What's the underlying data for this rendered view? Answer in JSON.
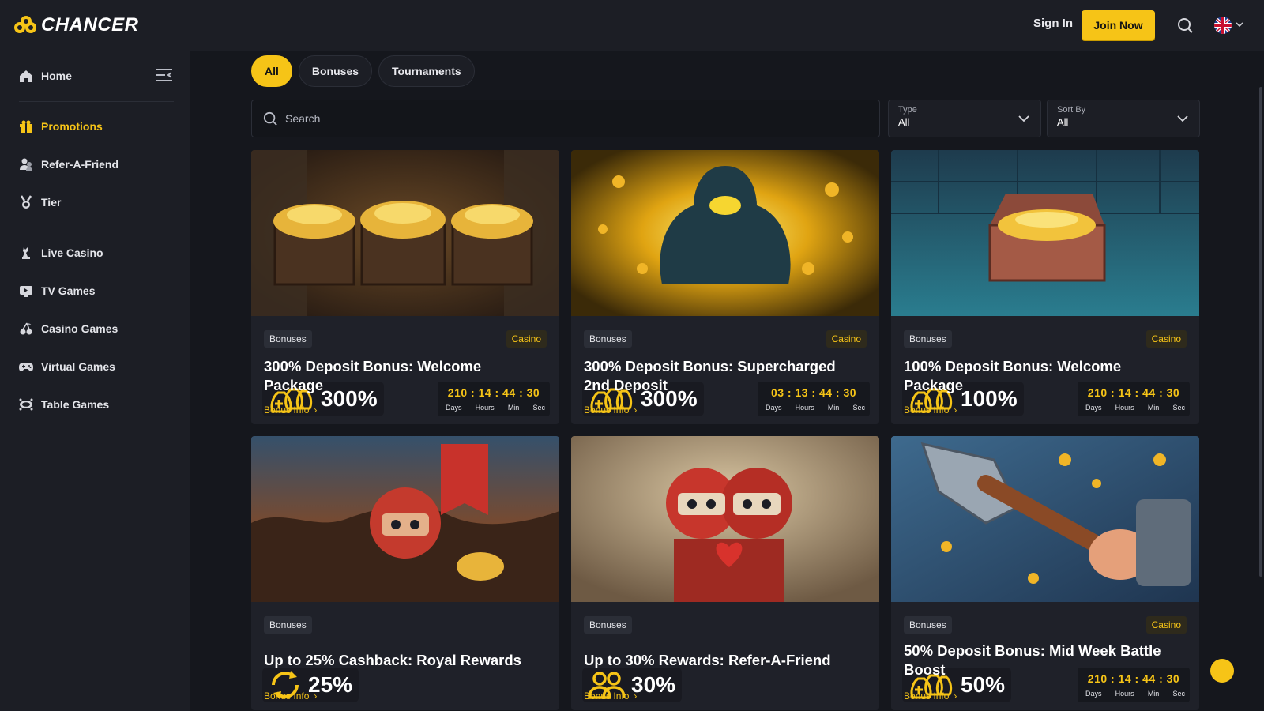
{
  "header": {
    "logo_text": "CHANCER",
    "sign_in": "Sign In",
    "join_now": "Join Now",
    "language_icon": "uk-flag-icon"
  },
  "sidebar": {
    "items": [
      {
        "label": "Home",
        "icon": "home-icon"
      },
      {
        "label": "Promotions",
        "icon": "gift-icon",
        "active": true
      },
      {
        "label": "Refer-A-Friend",
        "icon": "users-icon"
      },
      {
        "label": "Tier",
        "icon": "medal-icon"
      },
      {
        "label": "Live Casino",
        "icon": "chess-piece-icon"
      },
      {
        "label": "TV Games",
        "icon": "tv-icon"
      },
      {
        "label": "Casino Games",
        "icon": "cherries-icon"
      },
      {
        "label": "Virtual Games",
        "icon": "gamepad-icon"
      },
      {
        "label": "Table Games",
        "icon": "table-icon"
      }
    ]
  },
  "tabs": [
    {
      "label": "All",
      "active": true
    },
    {
      "label": "Bonuses"
    },
    {
      "label": "Tournaments"
    }
  ],
  "search": {
    "placeholder": "Search"
  },
  "filters": {
    "type": {
      "label": "Type",
      "value": "All"
    },
    "sort": {
      "label": "Sort By",
      "value": "All"
    }
  },
  "timer_units": [
    "Days",
    "Hours",
    "Min",
    "Sec"
  ],
  "cards": [
    {
      "pct": "300%",
      "timer": "210 : 14 : 44 : 30",
      "tag": "Bonuses",
      "category": "Casino",
      "title": "300% Deposit Bonus: Welcome Package",
      "link": "Bonus Info"
    },
    {
      "pct": "300%",
      "timer": "03 : 13 : 44 : 30",
      "tag": "Bonuses",
      "category": "Casino",
      "title": "300% Deposit Bonus: Supercharged 2nd Deposit",
      "link": "Bonus Info"
    },
    {
      "pct": "100%",
      "timer": "210 : 14 : 44 : 30",
      "tag": "Bonuses",
      "category": "Casino",
      "title": "100% Deposit Bonus: Welcome Package",
      "link": "Bonus Info"
    },
    {
      "pct": "25%",
      "tag": "Bonuses",
      "title": "Up to 25% Cashback: Royal Rewards",
      "link": "Bonus Info"
    },
    {
      "pct": "30%",
      "tag": "Bonuses",
      "title": "Up to 30% Rewards: Refer-A-Friend",
      "link": "Bonus Info"
    },
    {
      "pct": "50%",
      "timer": "210 : 14 : 44 : 30",
      "tag": "Bonuses",
      "category": "Casino",
      "title": "50% Deposit Bonus: Mid Week Battle Boost",
      "link": "Bonus Info"
    }
  ],
  "colors": {
    "accent": "#f6c417",
    "bg": "#15171d",
    "panel": "#1c1e25"
  }
}
